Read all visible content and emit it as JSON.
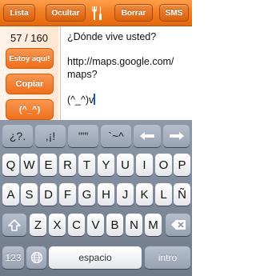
{
  "toolbar": {
    "list_label": "Lista",
    "hide_label": "Ocultar",
    "tools_icon": "wrench-screwdriver-icon",
    "clear_label": "Borrar",
    "sms_label": "SMS"
  },
  "left_pane": {
    "counter": "57 / 160",
    "here_label": "Estoy aquí!",
    "copy_label": "Copiar",
    "emoticon_label": "(^_^)"
  },
  "editor": {
    "text": "¿Dónde vive usted?\n\nhttp://maps.google.com/\nmaps?\n\n(^_^)v"
  },
  "keyboard": {
    "punct_row": [
      "¿?.",
      ",¡!",
      "'\"\"",
      "`~^"
    ],
    "row1": [
      "Q",
      "W",
      "E",
      "R",
      "T",
      "Y",
      "U",
      "I",
      "O",
      "P"
    ],
    "row2": [
      "A",
      "S",
      "D",
      "F",
      "G",
      "H",
      "J",
      "K",
      "L",
      "Ñ"
    ],
    "row3": [
      "Z",
      "X",
      "C",
      "V",
      "B",
      "N",
      "M"
    ],
    "numbers_label": "123",
    "space_label": "espacio",
    "return_label": "intro",
    "icons": {
      "left": "arrow-left-icon",
      "right": "arrow-right-icon",
      "shift": "shift-icon",
      "backspace": "backspace-icon",
      "globe": "globe-icon"
    }
  },
  "colors": {
    "toolbar_orange": "#f07a1f",
    "side_button_orange": "#ee6f1c",
    "keyboard_gray": "#7f8999",
    "caret_blue": "#1a4fd6"
  }
}
